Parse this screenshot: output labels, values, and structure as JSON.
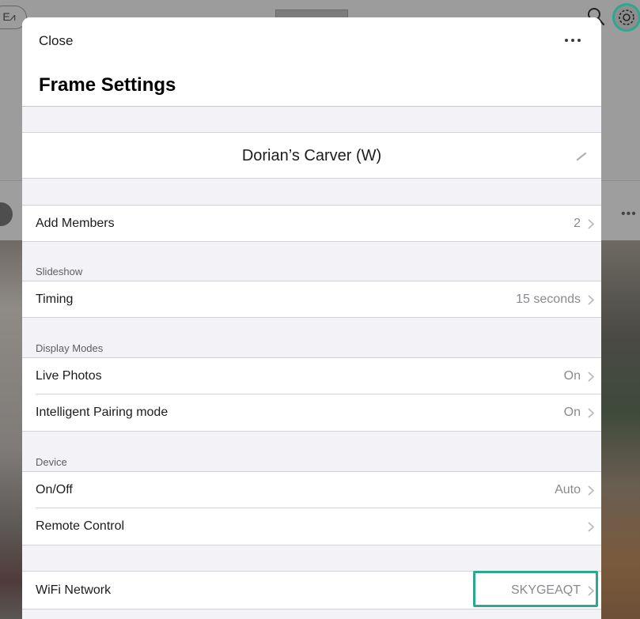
{
  "background": {
    "logo_text": "E⩘"
  },
  "sheet": {
    "close_label": "Close",
    "title": "Frame Settings",
    "frame_name": "Dorian’s Carver (W)"
  },
  "rows": {
    "add_members": {
      "label": "Add Members",
      "value": "2"
    },
    "timing": {
      "label": "Timing",
      "value": "15 seconds"
    },
    "live_photos": {
      "label": "Live Photos",
      "value": "On"
    },
    "pairing": {
      "label": "Intelligent Pairing mode",
      "value": "On"
    },
    "on_off": {
      "label": "On/Off",
      "value": "Auto"
    },
    "remote": {
      "label": "Remote Control",
      "value": ""
    },
    "wifi": {
      "label": "WiFi Network",
      "value": "SKYGEAQT"
    }
  },
  "sections": {
    "slideshow": "Slideshow",
    "display_modes": "Display Modes",
    "device": "Device"
  },
  "colors": {
    "accent_highlight": "#2aa891",
    "sheet_bg": "#f2f2f7",
    "secondary_text": "#8a8a8e"
  },
  "icons": [
    "search-icon",
    "gear-icon",
    "more-icon",
    "pencil-icon",
    "chevron-right-icon"
  ]
}
